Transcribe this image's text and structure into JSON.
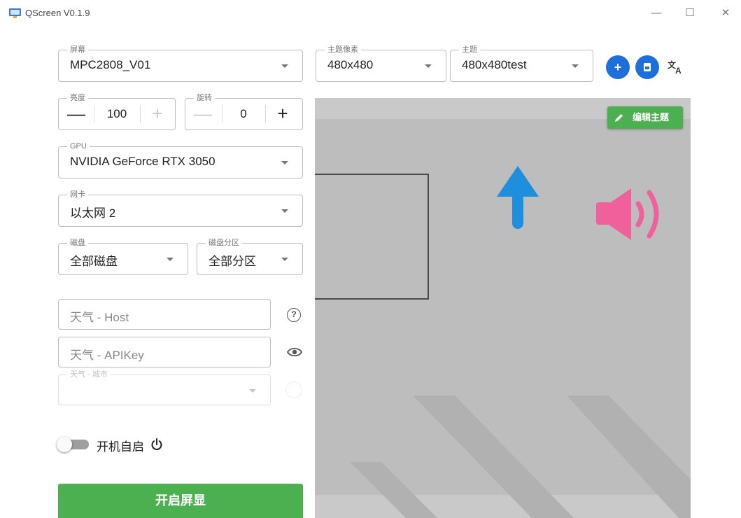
{
  "window": {
    "title": "QScreen V0.1.9",
    "minimize": "—",
    "maximize": "☐",
    "close": "✕"
  },
  "screen": {
    "label": "屏幕",
    "value": "MPC2808_V01"
  },
  "pixel": {
    "label": "主题像素",
    "value": "480x480"
  },
  "theme": {
    "label": "主题",
    "value": "480x480test"
  },
  "brightness": {
    "label": "亮度",
    "value": "100",
    "minus": "—",
    "plus": "+"
  },
  "rotation": {
    "label": "旋转",
    "value": "0",
    "minus": "—",
    "plus": "+"
  },
  "gpu": {
    "label": "GPU",
    "value": "NVIDIA GeForce RTX 3050"
  },
  "nic": {
    "label": "网卡",
    "value": "以太网 2"
  },
  "disk": {
    "label": "磁盘",
    "value": "全部磁盘"
  },
  "partition": {
    "label": "磁盘分区",
    "value": "全部分区"
  },
  "weather": {
    "host_placeholder": "天气 - Host",
    "apikey_placeholder": "天气 - APIKey",
    "city_label": "天气 - 城市",
    "help_icon": "?"
  },
  "autostart": {
    "label": "开机自启"
  },
  "buttons": {
    "add": "+",
    "edit_theme": "编辑主题",
    "start": "开启屏显",
    "translate": "文A"
  },
  "colors": {
    "primary": "#1e6fd9",
    "green": "#4caf50",
    "arrow": "#1e8fdc",
    "speaker": "#f0609a"
  }
}
